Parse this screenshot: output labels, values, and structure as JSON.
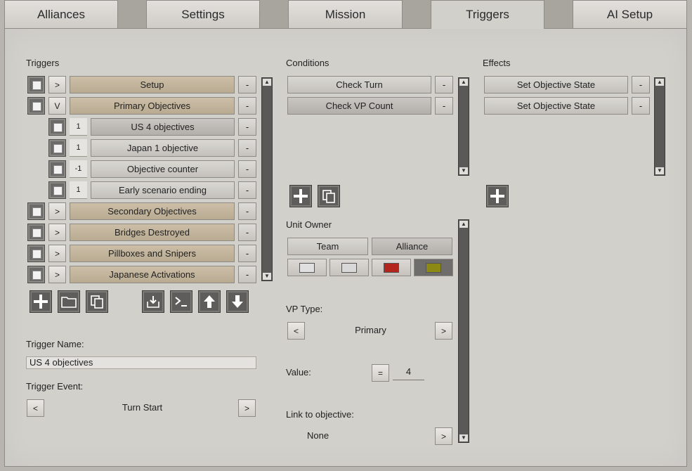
{
  "tabs": [
    "Alliances",
    "Settings",
    "Mission",
    "Triggers",
    "AI Setup"
  ],
  "triggers": {
    "header": "Triggers",
    "items": [
      {
        "toggle": ">",
        "label": "Setup",
        "style": "tan",
        "indent": 0
      },
      {
        "toggle": "V",
        "label": "Primary Objectives",
        "style": "tan",
        "indent": 0
      },
      {
        "toggle": "1",
        "label": "US 4 objectives",
        "style": "gray",
        "indent": 1
      },
      {
        "toggle": "1",
        "label": "Japan 1 objective",
        "style": "gray",
        "indent": 1
      },
      {
        "toggle": "-1",
        "label": "Objective counter",
        "style": "gray",
        "indent": 1
      },
      {
        "toggle": "1",
        "label": "Early scenario ending",
        "style": "gray",
        "indent": 1
      },
      {
        "toggle": ">",
        "label": "Secondary Objectives",
        "style": "tan",
        "indent": 0
      },
      {
        "toggle": ">",
        "label": "Bridges Destroyed",
        "style": "tan",
        "indent": 0
      },
      {
        "toggle": ">",
        "label": "Pillboxes and Snipers",
        "style": "tan",
        "indent": 0
      },
      {
        "toggle": ">",
        "label": "Japanese Activations",
        "style": "tan",
        "indent": 0
      }
    ],
    "minus": "-",
    "name_label": "Trigger Name:",
    "name_value": "US 4 objectives",
    "event_label": "Trigger Event:",
    "event_value": "Turn Start",
    "prev": "<",
    "next": ">"
  },
  "conditions": {
    "header": "Conditions",
    "items": [
      "Check Turn",
      "Check VP Count"
    ],
    "unit_owner_label": "Unit Owner",
    "owner_options": [
      "Team",
      "Alliance"
    ],
    "colors": [
      "#e0e0e0",
      "#d8d8d8",
      "#b3261e",
      "#8c8a14"
    ],
    "vp_type_label": "VP Type:",
    "vp_type_value": "Primary",
    "value_label": "Value:",
    "value_op": "=",
    "value_value": "4",
    "link_label": "Link to objective:",
    "link_value": "None"
  },
  "effects": {
    "header": "Effects",
    "items": [
      "Set Objective State",
      "Set Objective State"
    ]
  }
}
